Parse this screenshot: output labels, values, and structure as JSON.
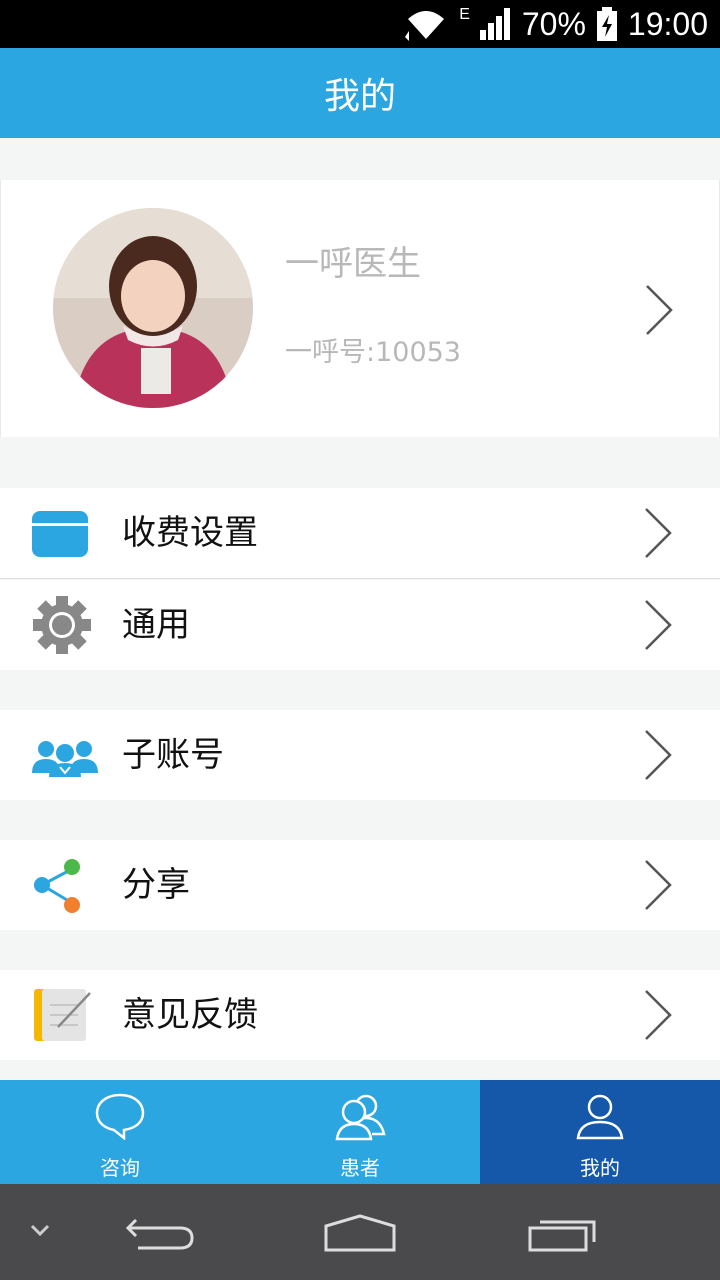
{
  "status_bar": {
    "network": "E",
    "battery": "70%",
    "time": "19:00"
  },
  "header": {
    "title": "我的"
  },
  "profile": {
    "name": "一呼医生",
    "id_text": "一呼号:10053"
  },
  "menu": {
    "fee_settings": "收费设置",
    "general": "通用",
    "sub_accounts": "子账号",
    "share": "分享",
    "feedback": "意见反馈"
  },
  "tabs": [
    {
      "label": "咨询",
      "icon": "chat-bubble-icon"
    },
    {
      "label": "患者",
      "icon": "patients-icon"
    },
    {
      "label": "我的",
      "icon": "person-icon",
      "active": true
    }
  ],
  "colors": {
    "primary": "#2ba6e1",
    "active_tab": "#1558a9",
    "background": "#f4f5f5"
  }
}
